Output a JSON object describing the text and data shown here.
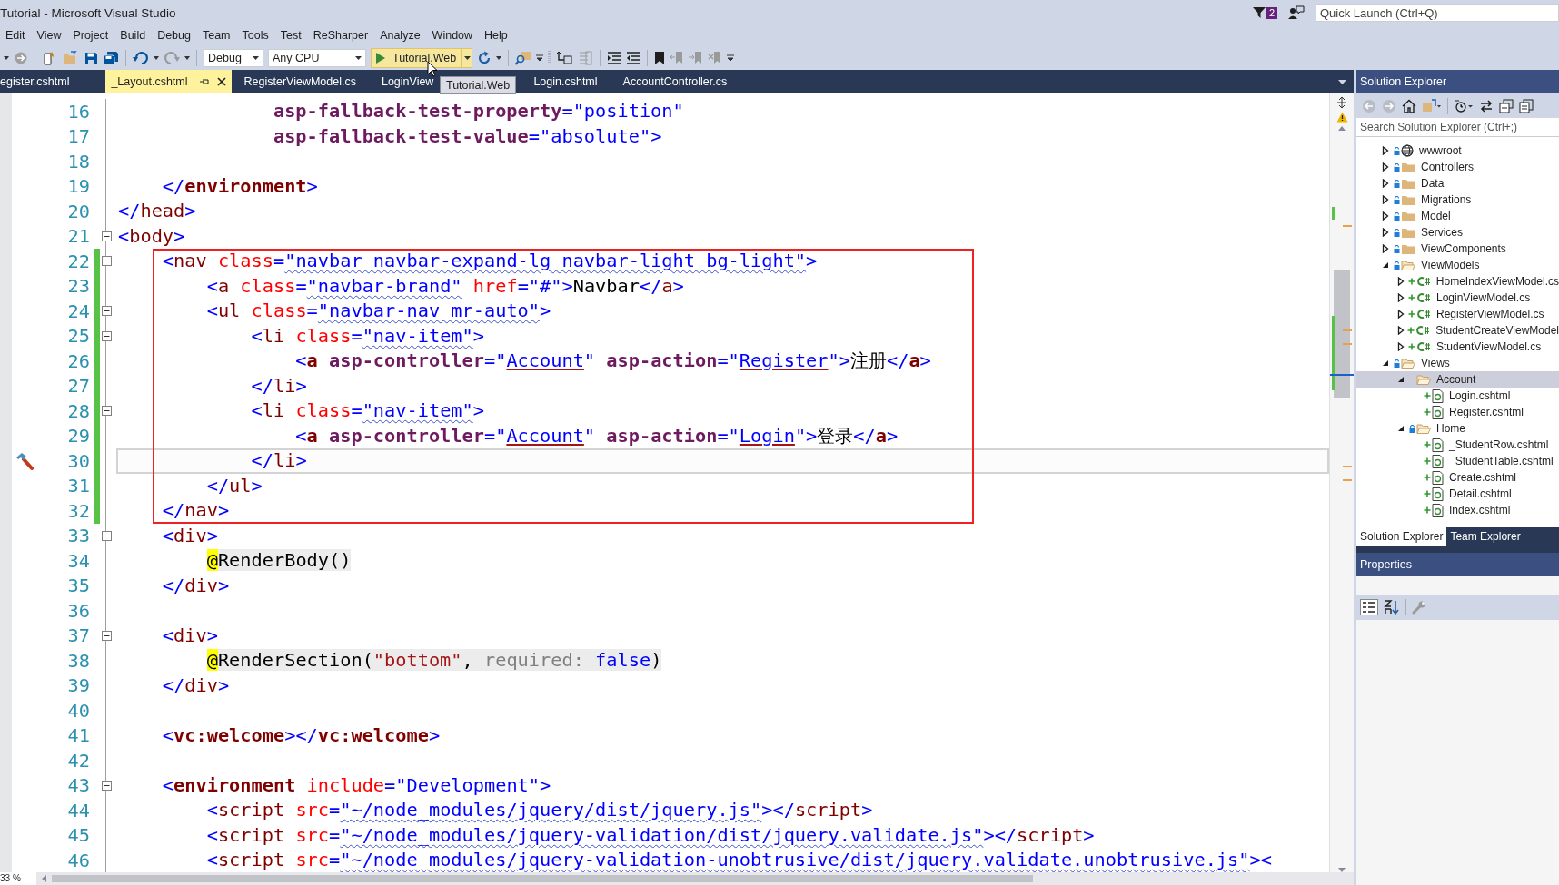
{
  "window": {
    "title": "Tutorial - Microsoft Visual Studio"
  },
  "notifications": {
    "count": "2"
  },
  "quick_launch": {
    "placeholder": "Quick Launch (Ctrl+Q)"
  },
  "menu": [
    "Edit",
    "View",
    "Project",
    "Build",
    "Debug",
    "Team",
    "Tools",
    "Test",
    "ReSharper",
    "Analyze",
    "Window",
    "Help"
  ],
  "toolbar": {
    "configuration": "Debug",
    "platform": "Any CPU",
    "start_target": "Tutorial.Web",
    "tooltip": "Tutorial.Web"
  },
  "tabs": [
    {
      "label": "egister.cshtml",
      "selected": false
    },
    {
      "label": "_Layout.cshtml",
      "selected": true
    },
    {
      "label": "RegisterViewModel.cs",
      "selected": false
    },
    {
      "label": "LoginView",
      "selected": false
    },
    {
      "label": "Login.cshtml",
      "selected": false
    },
    {
      "label": "AccountController.cs",
      "selected": false
    }
  ],
  "editor": {
    "zoom": "33 %",
    "lines_above": [
      {
        "number": "16",
        "tokens": [
          {
            "text": "              asp-fallback-test-property",
            "kind": "attrbold"
          },
          {
            "text": "=",
            "kind": "delim"
          },
          {
            "text": "\"position\"",
            "kind": "str"
          }
        ]
      },
      {
        "number": "17",
        "tokens": [
          {
            "text": "              asp-fallback-test-value",
            "kind": "attrbold"
          },
          {
            "text": "=",
            "kind": "delim"
          },
          {
            "text": "\"absolute\"",
            "kind": "str"
          },
          {
            "text": ">",
            "kind": "delim"
          }
        ]
      },
      {
        "number": "18"
      },
      {
        "number": "19",
        "tokens": [
          {
            "text": "    </",
            "kind": "delim"
          },
          {
            "text": "environment",
            "kind": "tagbold"
          },
          {
            "text": ">",
            "kind": "delim"
          }
        ]
      },
      {
        "number": "20",
        "tokens": [
          {
            "text": "</",
            "kind": "delim"
          },
          {
            "text": "head",
            "kind": "tag"
          },
          {
            "text": ">",
            "kind": "delim"
          }
        ]
      },
      {
        "number": "21",
        "fold": true,
        "tokens": [
          {
            "text": "<",
            "kind": "delim"
          },
          {
            "text": "body",
            "kind": "tag"
          },
          {
            "text": ">",
            "kind": "delim"
          }
        ]
      }
    ],
    "framed_lines": [
      {
        "number": "22",
        "fold": true,
        "changed": true,
        "tokens": [
          {
            "text": "    <",
            "kind": "delim"
          },
          {
            "text": "nav",
            "kind": "tag"
          },
          {
            "text": " class",
            "kind": "attr"
          },
          {
            "text": "=",
            "kind": "delim"
          },
          {
            "text": "\"navbar navbar-expand-lg navbar-light bg-light\"",
            "kind": "str",
            "squiggle": true
          },
          {
            "text": ">",
            "kind": "delim"
          }
        ]
      },
      {
        "number": "23",
        "changed": true,
        "tokens": [
          {
            "text": "        <",
            "kind": "delim"
          },
          {
            "text": "a",
            "kind": "tag"
          },
          {
            "text": " class",
            "kind": "attr"
          },
          {
            "text": "=",
            "kind": "delim"
          },
          {
            "text": "\"navbar-brand\"",
            "kind": "str",
            "squiggle": true
          },
          {
            "text": " href",
            "kind": "attr"
          },
          {
            "text": "=",
            "kind": "delim"
          },
          {
            "text": "\"#\"",
            "kind": "str"
          },
          {
            "text": ">",
            "kind": "delim"
          },
          {
            "text": "Navbar",
            "kind": "text"
          },
          {
            "text": "</",
            "kind": "delim"
          },
          {
            "text": "a",
            "kind": "tag"
          },
          {
            "text": ">",
            "kind": "delim"
          }
        ]
      },
      {
        "number": "24",
        "fold": true,
        "changed": true,
        "tokens": [
          {
            "text": "        <",
            "kind": "delim"
          },
          {
            "text": "ul",
            "kind": "tag"
          },
          {
            "text": " class",
            "kind": "attr"
          },
          {
            "text": "=",
            "kind": "delim"
          },
          {
            "text": "\"navbar-nav mr-auto\"",
            "kind": "str",
            "squiggle": true
          },
          {
            "text": ">",
            "kind": "delim"
          }
        ]
      },
      {
        "number": "25",
        "fold": true,
        "changed": true,
        "tokens": [
          {
            "text": "            <",
            "kind": "delim"
          },
          {
            "text": "li",
            "kind": "tag"
          },
          {
            "text": " class",
            "kind": "attr"
          },
          {
            "text": "=",
            "kind": "delim"
          },
          {
            "text": "\"nav-item\"",
            "kind": "str",
            "squiggle": true
          },
          {
            "text": ">",
            "kind": "delim"
          }
        ]
      },
      {
        "number": "26",
        "changed": true,
        "tokens": [
          {
            "text": "                <",
            "kind": "delim"
          },
          {
            "text": "a",
            "kind": "tagbold"
          },
          {
            "text": " asp-controller",
            "kind": "attrbold"
          },
          {
            "text": "=\"",
            "kind": "str"
          },
          {
            "text": "Account",
            "kind": "link"
          },
          {
            "text": "\"",
            "kind": "str"
          },
          {
            "text": " asp-action",
            "kind": "attrbold"
          },
          {
            "text": "=\"",
            "kind": "str"
          },
          {
            "text": "Register",
            "kind": "link"
          },
          {
            "text": "\"",
            "kind": "str"
          },
          {
            "text": ">",
            "kind": "delim"
          },
          {
            "text": "注册",
            "kind": "text"
          },
          {
            "text": "</",
            "kind": "delim"
          },
          {
            "text": "a",
            "kind": "tagbold"
          },
          {
            "text": ">",
            "kind": "delim"
          }
        ]
      },
      {
        "number": "27",
        "changed": true,
        "tokens": [
          {
            "text": "            </",
            "kind": "delim"
          },
          {
            "text": "li",
            "kind": "tag"
          },
          {
            "text": ">",
            "kind": "delim"
          }
        ]
      },
      {
        "number": "28",
        "fold": true,
        "changed": true,
        "tokens": [
          {
            "text": "            <",
            "kind": "delim"
          },
          {
            "text": "li",
            "kind": "tag"
          },
          {
            "text": " class",
            "kind": "attr"
          },
          {
            "text": "=",
            "kind": "delim"
          },
          {
            "text": "\"nav-item\"",
            "kind": "str",
            "squiggle": true
          },
          {
            "text": ">",
            "kind": "delim"
          }
        ]
      },
      {
        "number": "29",
        "changed": true,
        "tokens": [
          {
            "text": "                <",
            "kind": "delim"
          },
          {
            "text": "a",
            "kind": "tagbold"
          },
          {
            "text": " asp-controller",
            "kind": "attrbold"
          },
          {
            "text": "=\"",
            "kind": "str"
          },
          {
            "text": "Account",
            "kind": "link"
          },
          {
            "text": "\"",
            "kind": "str"
          },
          {
            "text": " asp-action",
            "kind": "attrbold"
          },
          {
            "text": "=\"",
            "kind": "str"
          },
          {
            "text": "Login",
            "kind": "link"
          },
          {
            "text": "\"",
            "kind": "str"
          },
          {
            "text": ">",
            "kind": "delim"
          },
          {
            "text": "登录",
            "kind": "text"
          },
          {
            "text": "</",
            "kind": "delim"
          },
          {
            "text": "a",
            "kind": "tagbold"
          },
          {
            "text": ">",
            "kind": "delim"
          }
        ]
      },
      {
        "number": "30",
        "changed": true,
        "current": true,
        "quick_action": true,
        "tokens": [
          {
            "text": "            </",
            "kind": "delim"
          },
          {
            "text": "li",
            "kind": "tag"
          },
          {
            "text": ">",
            "kind": "delim"
          }
        ]
      },
      {
        "number": "31",
        "changed": true,
        "tokens": [
          {
            "text": "        </",
            "kind": "delim"
          },
          {
            "text": "ul",
            "kind": "tag"
          },
          {
            "text": ">",
            "kind": "delim"
          }
        ]
      },
      {
        "number": "32",
        "changed": true,
        "tokens": [
          {
            "text": "    </",
            "kind": "delim"
          },
          {
            "text": "nav",
            "kind": "tag"
          },
          {
            "text": ">",
            "kind": "delim"
          }
        ]
      }
    ],
    "lines_below": [
      {
        "number": "33",
        "fold": true,
        "tokens": [
          {
            "text": "    <",
            "kind": "delim"
          },
          {
            "text": "div",
            "kind": "tag"
          },
          {
            "text": ">",
            "kind": "delim"
          }
        ]
      },
      {
        "number": "34",
        "tokens": [
          {
            "text": "        @",
            "kind": "razor"
          },
          {
            "text": "RenderBody()",
            "kind": "code"
          }
        ]
      },
      {
        "number": "35",
        "tokens": [
          {
            "text": "    </",
            "kind": "delim"
          },
          {
            "text": "div",
            "kind": "tag"
          },
          {
            "text": ">",
            "kind": "delim"
          }
        ]
      },
      {
        "number": "36"
      },
      {
        "number": "37",
        "fold": true,
        "tokens": [
          {
            "text": "    <",
            "kind": "delim"
          },
          {
            "text": "div",
            "kind": "tag"
          },
          {
            "text": ">",
            "kind": "delim"
          }
        ]
      },
      {
        "number": "38",
        "tokens": [
          {
            "text": "        @",
            "kind": "razor"
          },
          {
            "text": "RenderSection(",
            "kind": "code"
          },
          {
            "text": "\"bottom\"",
            "kind": "cstr"
          },
          {
            "text": ", ",
            "kind": "code"
          },
          {
            "text": "required:",
            "kind": "param"
          },
          {
            "text": " false",
            "kind": "keyword"
          },
          {
            "text": ")",
            "kind": "code"
          }
        ]
      },
      {
        "number": "39",
        "tokens": [
          {
            "text": "    </",
            "kind": "delim"
          },
          {
            "text": "div",
            "kind": "tag"
          },
          {
            "text": ">",
            "kind": "delim"
          }
        ]
      },
      {
        "number": "40"
      },
      {
        "number": "41",
        "tokens": [
          {
            "text": "    <",
            "kind": "delim"
          },
          {
            "text": "vc:welcome",
            "kind": "tagbold"
          },
          {
            "text": "></",
            "kind": "delim"
          },
          {
            "text": "vc:welcome",
            "kind": "tagbold"
          },
          {
            "text": ">",
            "kind": "delim"
          }
        ]
      },
      {
        "number": "42"
      },
      {
        "number": "43",
        "fold": true,
        "tokens": [
          {
            "text": "    <",
            "kind": "delim"
          },
          {
            "text": "environment",
            "kind": "tagbold"
          },
          {
            "text": " include",
            "kind": "attr"
          },
          {
            "text": "=",
            "kind": "delim"
          },
          {
            "text": "\"Development\"",
            "kind": "str"
          },
          {
            "text": ">",
            "kind": "delim"
          }
        ]
      },
      {
        "number": "44",
        "tokens": [
          {
            "text": "        <",
            "kind": "delim"
          },
          {
            "text": "script",
            "kind": "tag"
          },
          {
            "text": " src",
            "kind": "attr"
          },
          {
            "text": "=",
            "kind": "delim"
          },
          {
            "text": "\"~/node_modules/jquery/dist/jquery.js\"",
            "kind": "str",
            "squiggle": true
          },
          {
            "text": "></",
            "kind": "delim"
          },
          {
            "text": "script",
            "kind": "tag"
          },
          {
            "text": ">",
            "kind": "delim"
          }
        ]
      },
      {
        "number": "45",
        "tokens": [
          {
            "text": "        <",
            "kind": "delim"
          },
          {
            "text": "script",
            "kind": "tag"
          },
          {
            "text": " src",
            "kind": "attr"
          },
          {
            "text": "=",
            "kind": "delim"
          },
          {
            "text": "\"~/node_modules/jquery-validation/dist/jquery.validate.js\"",
            "kind": "str",
            "squiggle": true
          },
          {
            "text": "></",
            "kind": "delim"
          },
          {
            "text": "script",
            "kind": "tag"
          },
          {
            "text": ">",
            "kind": "delim"
          }
        ]
      },
      {
        "number": "46",
        "tokens": [
          {
            "text": "        <",
            "kind": "delim"
          },
          {
            "text": "script",
            "kind": "tag"
          },
          {
            "text": " src",
            "kind": "attr"
          },
          {
            "text": "=",
            "kind": "delim"
          },
          {
            "text": "\"~/node_modules/jquery-validation-unobtrusive/dist/jquery.validate.unobtrusive.js\"",
            "kind": "str",
            "squiggle": true
          },
          {
            "text": "><",
            "kind": "delim"
          }
        ]
      }
    ]
  },
  "solution_explorer": {
    "title": "Solution Explorer",
    "search_placeholder": "Search Solution Explorer (Ctrl+;)",
    "tree": [
      {
        "label": "wwwroot",
        "kind": "globe",
        "locked": true,
        "added": false,
        "expanded": false,
        "selected": false
      },
      {
        "label": "Controllers",
        "kind": "folder",
        "locked": true,
        "added": false,
        "expanded": false,
        "selected": false
      },
      {
        "label": "Data",
        "kind": "folder",
        "locked": true,
        "added": false,
        "expanded": false,
        "selected": false
      },
      {
        "label": "Migrations",
        "kind": "folder",
        "locked": true,
        "added": false,
        "expanded": false,
        "selected": false
      },
      {
        "label": "Model",
        "kind": "folder",
        "locked": true,
        "added": false,
        "expanded": false,
        "selected": false
      },
      {
        "label": "Services",
        "kind": "folder",
        "locked": true,
        "added": false,
        "expanded": false,
        "selected": false
      },
      {
        "label": "ViewComponents",
        "kind": "folder",
        "locked": true,
        "added": false,
        "expanded": false,
        "selected": false
      },
      {
        "label": "ViewModels",
        "kind": "folder",
        "locked": true,
        "added": false,
        "expanded": true,
        "selected": false,
        "children": [
          {
            "label": "HomeIndexViewModel.cs",
            "kind": "csharp",
            "locked": false,
            "added": true,
            "expanded": false,
            "selected": false
          },
          {
            "label": "LoginViewModel.cs",
            "kind": "csharp",
            "locked": false,
            "added": true,
            "expanded": false,
            "selected": false
          },
          {
            "label": "RegisterViewModel.cs",
            "kind": "csharp",
            "locked": false,
            "added": true,
            "expanded": false,
            "selected": false
          },
          {
            "label": "StudentCreateViewModel",
            "kind": "csharp",
            "locked": false,
            "added": true,
            "expanded": false,
            "selected": false
          },
          {
            "label": "StudentViewModel.cs",
            "kind": "csharp",
            "locked": false,
            "added": true,
            "expanded": false,
            "selected": false
          }
        ]
      },
      {
        "label": "Views",
        "kind": "folder",
        "locked": true,
        "added": false,
        "expanded": true,
        "selected": false,
        "children": [
          {
            "label": "Account",
            "kind": "folder",
            "locked": false,
            "added": false,
            "expanded": true,
            "selected": true,
            "children": [
              {
                "label": "Login.cshtml",
                "kind": "razor",
                "locked": false,
                "added": true,
                "selected": false
              },
              {
                "label": "Register.cshtml",
                "kind": "razor",
                "locked": false,
                "added": true,
                "selected": false
              }
            ]
          },
          {
            "label": "Home",
            "kind": "folder",
            "locked": true,
            "added": false,
            "expanded": true,
            "selected": false,
            "children": [
              {
                "label": "_StudentRow.cshtml",
                "kind": "razor",
                "locked": false,
                "added": true,
                "selected": false
              },
              {
                "label": "_StudentTable.cshtml",
                "kind": "razor",
                "locked": false,
                "added": true,
                "selected": false
              },
              {
                "label": "Create.cshtml",
                "kind": "razor",
                "locked": false,
                "added": true,
                "selected": false
              },
              {
                "label": "Detail.cshtml",
                "kind": "razor",
                "locked": false,
                "added": true,
                "selected": false
              },
              {
                "label": "Index.cshtml",
                "kind": "razor",
                "locked": false,
                "added": true,
                "selected": false
              }
            ]
          }
        ]
      }
    ],
    "tabs": [
      {
        "label": "Solution Explorer",
        "selected": true
      },
      {
        "label": "Team Explorer",
        "selected": false
      }
    ]
  },
  "properties": {
    "title": "Properties"
  }
}
